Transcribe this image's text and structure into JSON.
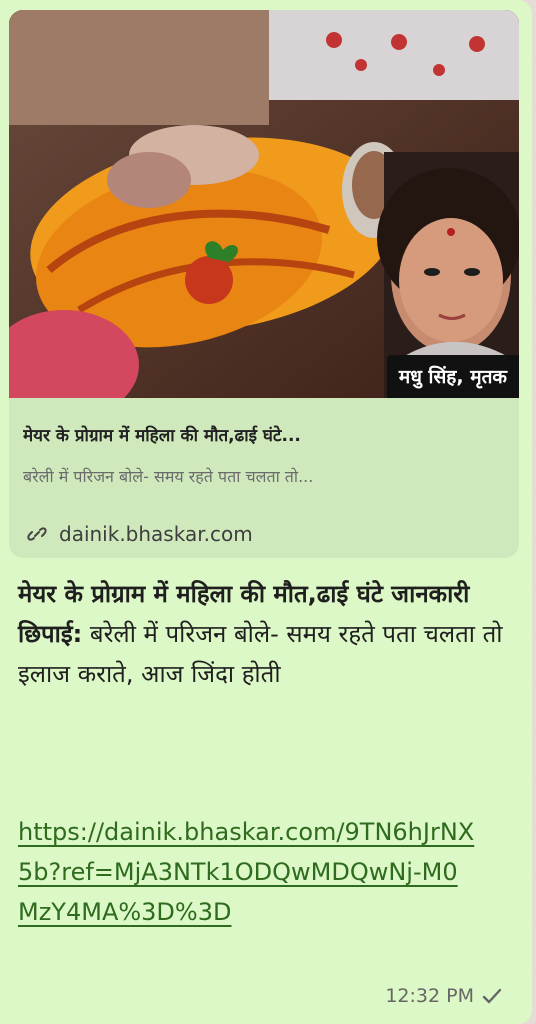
{
  "preview": {
    "image_caption": "मधु सिंह, मृतक",
    "title": "मेयर के प्रोग्राम में महिला की मौत,ढाई घंटे...",
    "description": "बरेली में परिजन बोले- समय रहते पता चलता तो...",
    "domain": "dainik.bhaskar.com",
    "link_icon": "link-icon"
  },
  "message": {
    "headline": "मेयर के प्रोग्राम में महिला की मौत,ढाई घंटे जानकारी छिपाई:",
    "body": " बरेली में परिजन बोले- समय रहते पता चलता तो इलाज कराते, आज जिंदा होती",
    "link": "https://dainik.bhaskar.com/9TN6hJrNX5b?ref=MjA3NTk1ODQwMDQwNj-M0MzY4MA%3D%3D",
    "time": "12:32 PM",
    "status_icon": "single-check-icon"
  },
  "colors": {
    "bubble": "#dcf8c6",
    "card": "#cfe9bc",
    "link": "#2e6b1f",
    "meta": "#666666"
  }
}
